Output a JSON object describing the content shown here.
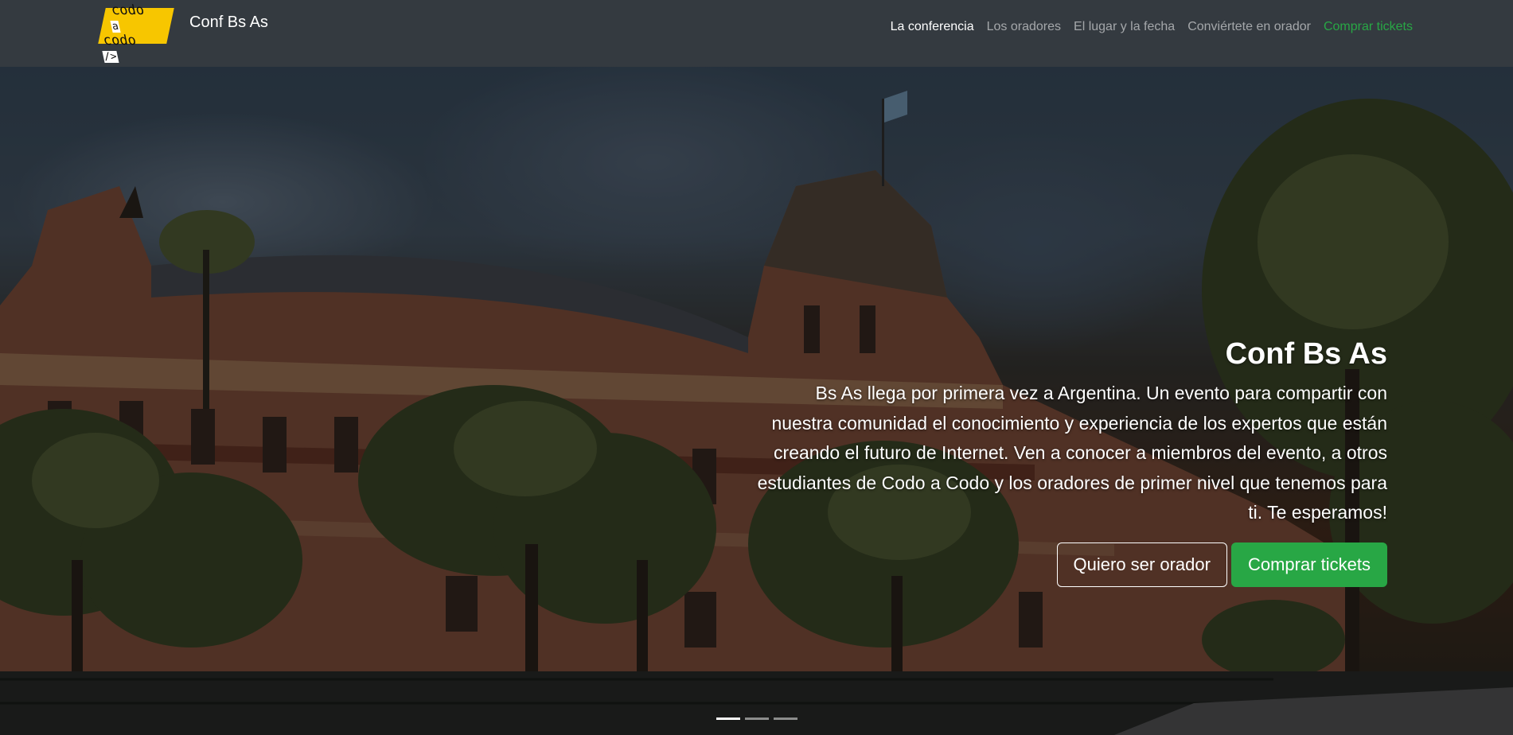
{
  "navbar": {
    "logo": {
      "line1": "codo",
      "line2": "codo",
      "mark1": "a",
      "mark2": "/>",
      "prefix": "<"
    },
    "brand_name": "Conf Bs As",
    "links": [
      {
        "label": "La conferencia"
      },
      {
        "label": "Los oradores"
      },
      {
        "label": "El lugar y la fecha"
      },
      {
        "label": "Conviértete en orador"
      },
      {
        "label": "Comprar tickets"
      }
    ]
  },
  "hero": {
    "title": "Conf Bs As",
    "description": "Bs As llega por primera vez a Argentina. Un evento para compartir con nuestra comunidad el conocimiento y experiencia de los expertos que están creando el futuro de Internet. Ven a conocer a miembros del evento, a otros estudiantes de Codo a Codo y los oradores de primer nivel que tenemos para ti. Te esperamos!",
    "primary_button": "Quiero ser orador",
    "secondary_button": "Comprar tickets",
    "slide_count": 3,
    "active_slide": 1
  },
  "colors": {
    "navbar_bg": "#343a40",
    "accent_green": "#28a745",
    "logo_yellow": "#f7c600"
  }
}
